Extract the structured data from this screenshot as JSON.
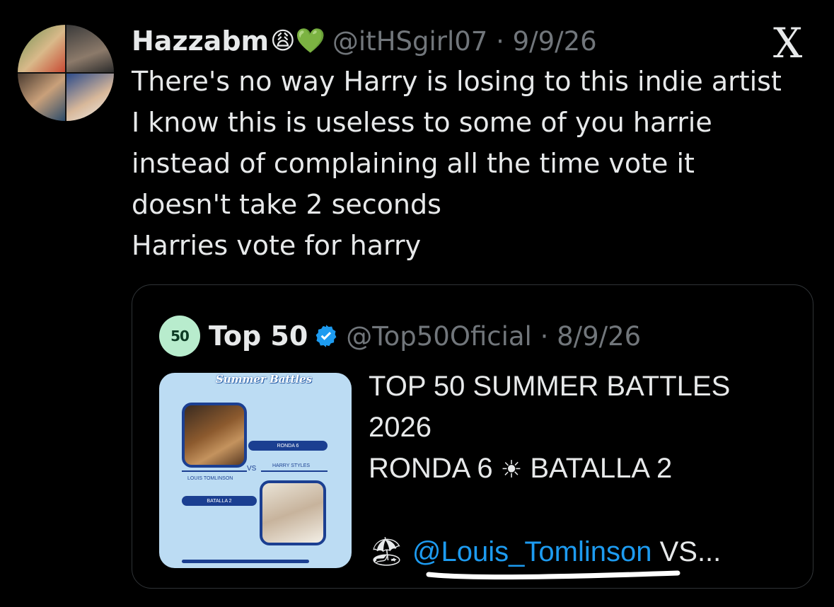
{
  "tweet": {
    "author_name": "Hazzabm",
    "author_emojis": "😩💚",
    "handle_date": "@itHSgirl07 · 9/9/26",
    "x_logo": "X",
    "lines": [
      "There's no way Harry is losing to this indie artist",
      "I know this is useless to some of you harrie",
      "instead of complaining all the time vote it",
      "doesn't take 2 seconds",
      "Harries vote for harry"
    ]
  },
  "quote": {
    "avatar_text": "50",
    "author_name": "Top 50",
    "handle_date": "@Top50Oficial · 8/9/26",
    "media": {
      "brand": "Summer Battles",
      "round_pill": "RONDA 6",
      "battle_pill": "BATALLA 2",
      "left_artist": "LOUIS TOMLINSON",
      "right_artist": "HARRY STYLES",
      "vs": "VS"
    },
    "text_lines": [
      "TOP 50 SUMMER BATTLES",
      "2026",
      "RONDA 6",
      "BATALLA 2"
    ],
    "sun_symbol": "☀",
    "beach_emoji": "🏖",
    "mention": "@Louis_Tomlinson",
    "trailing": " VS..."
  },
  "colors": {
    "background": "#000000",
    "text": "#e7e9ea",
    "muted": "#71767b",
    "link": "#1d9bf0",
    "verified": "#1d9bf0"
  }
}
